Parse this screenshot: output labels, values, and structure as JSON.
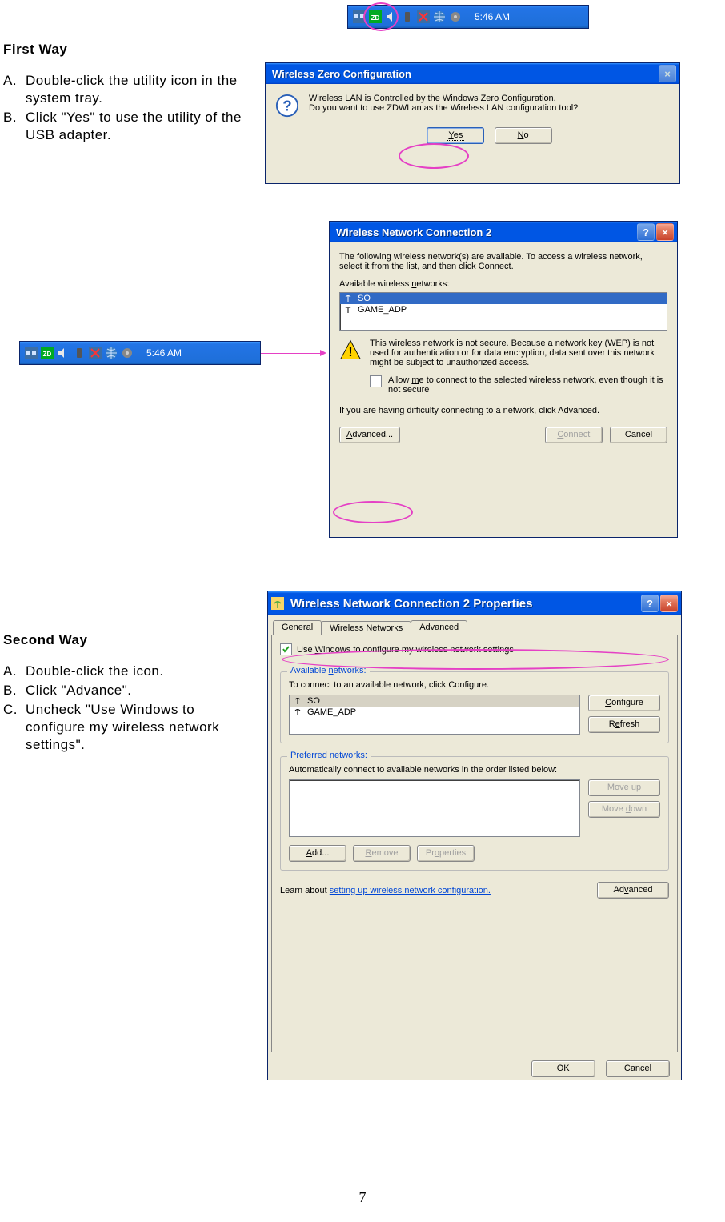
{
  "page_number": "7",
  "first_way": {
    "heading": "First Way",
    "steps": [
      {
        "letter": "A.",
        "text": "Double-click the utility icon in the system tray."
      },
      {
        "letter": "B.",
        "text": "Click \"Yes\" to use the utility of the USB adapter."
      }
    ]
  },
  "second_way": {
    "heading": "Second Way",
    "steps": [
      {
        "letter": "A.",
        "text": "Double-click the icon."
      },
      {
        "letter": "B.",
        "text": "Click \"Advance\"."
      },
      {
        "letter": "C.",
        "text": "Uncheck \"Use Windows to configure my wireless network settings\"."
      }
    ]
  },
  "taskbar": {
    "time": "5:46 AM"
  },
  "dialog_zero": {
    "title": "Wireless Zero Configuration",
    "body_line1": "Wireless LAN is Controlled by the Windows Zero Configuration.",
    "body_line2": "Do you want to use ZDWLan as the Wireless LAN configuration tool?",
    "yes": "Yes",
    "no": "No"
  },
  "dialog_conn": {
    "title": "Wireless Network Connection 2",
    "intro": "The following wireless network(s) are available. To access a wireless network, select it from the list, and then click Connect.",
    "available_label": "Available wireless networks:",
    "networks": [
      "SO",
      "GAME_ADP"
    ],
    "warning": "This wireless network is not secure. Because a network key (WEP) is not used for authentication or for data encryption, data sent over this network might be subject to unauthorized access.",
    "checkbox": "Allow me to connect to the selected wireless network, even though it is not secure",
    "difficulty": "If you are having difficulty connecting to a network, click Advanced.",
    "advanced": "Advanced...",
    "connect": "Connect",
    "cancel": "Cancel"
  },
  "dialog_props": {
    "title": "Wireless Network Connection 2 Properties",
    "tabs": [
      "General",
      "Wireless Networks",
      "Advanced"
    ],
    "use_windows": "Use Windows to configure my wireless network settings",
    "available_title": "Available networks:",
    "available_desc": "To connect to an available network, click Configure.",
    "networks": [
      "SO",
      "GAME_ADP"
    ],
    "configure": "Configure",
    "refresh": "Refresh",
    "preferred_title": "Preferred networks:",
    "preferred_desc": "Automatically connect to available networks in the order listed below:",
    "moveup": "Move up",
    "movedown": "Move down",
    "add": "Add...",
    "remove": "Remove",
    "properties": "Properties",
    "learn": "Learn about ",
    "learn_link": "setting up wireless network configuration.",
    "advanced": "Advanced",
    "ok": "OK",
    "cancel": "Cancel"
  }
}
